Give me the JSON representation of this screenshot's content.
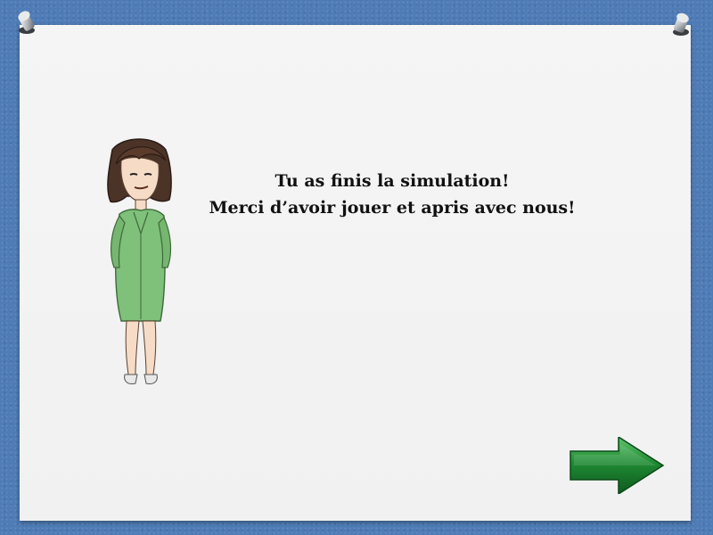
{
  "message": {
    "line1": "Tu as finis la simulation!",
    "line2": "Merci d’avoir jouer et apris avec nous!"
  },
  "character": {
    "description_icon": "teacher-character-icon"
  },
  "navigation": {
    "next_icon": "next-arrow-icon",
    "arrow_color": "#1e7a2e"
  },
  "colors": {
    "background": "#4f7cb6",
    "board": "#f3f3f3",
    "coat": "#7fc07a"
  }
}
